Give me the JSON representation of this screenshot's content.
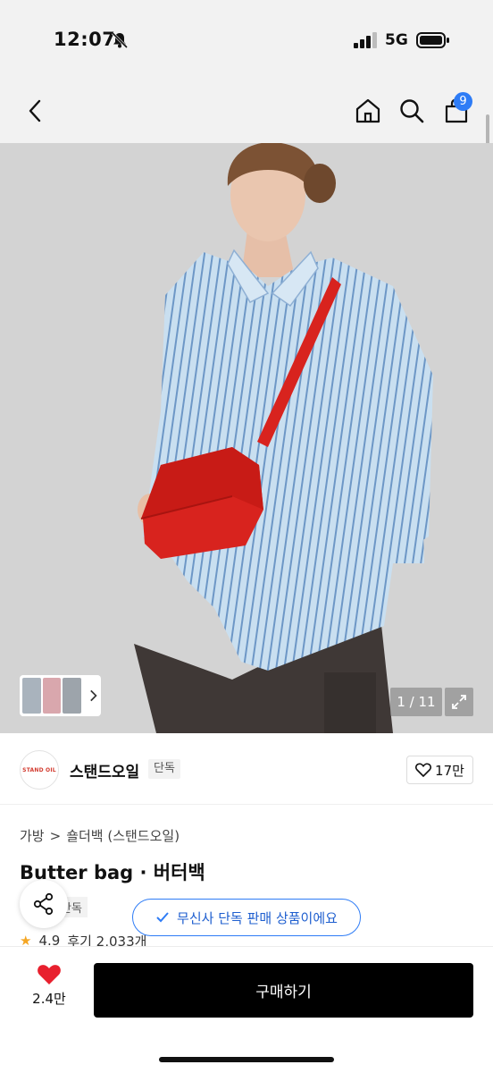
{
  "status_bar": {
    "time": "12:07",
    "network": "5G"
  },
  "nav": {
    "cart_count": "9"
  },
  "gallery": {
    "counter": "1 / 11"
  },
  "brand": {
    "logo_text": "STAND OIL",
    "name": "스탠드오일",
    "tag": "단독",
    "like_count": "17만"
  },
  "breadcrumb": {
    "category": "가방",
    "separator": ">",
    "subcategory": "숄더백 (스탠드오일)"
  },
  "product": {
    "title": "Butter bag · 버터백",
    "exclusive_tag": "단독",
    "rating": "4.9",
    "reviews": "후기 2,033개"
  },
  "toast": {
    "text": "무신사 단독 판매 상품이에요"
  },
  "bottom": {
    "likes": "2.4만",
    "buy_label": "구매하기"
  },
  "colors": {
    "accent_blue": "#2e7cf6",
    "bag_red": "#d8231e",
    "heart_red": "#e8202e"
  }
}
